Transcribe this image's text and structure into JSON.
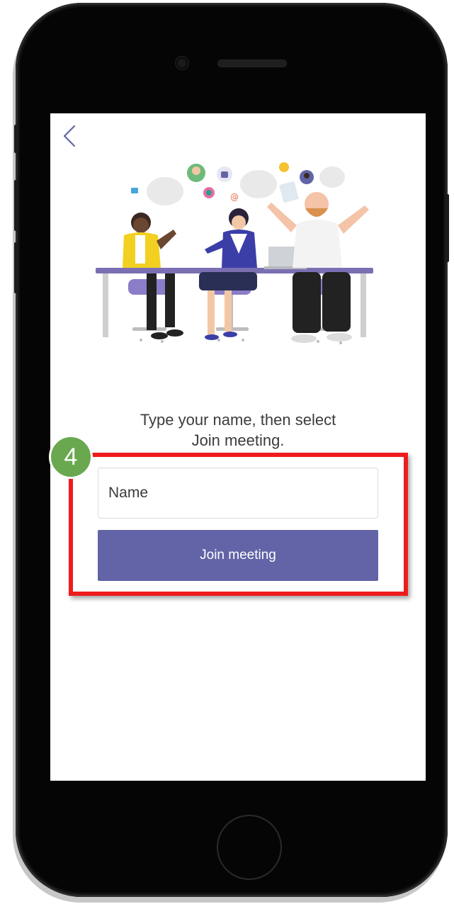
{
  "screen": {
    "back_icon": "chevron-left-icon",
    "illustration": "people-meeting-illustration",
    "instruction": "Type your name, then select\nJoin meeting.",
    "name_placeholder": "Name",
    "name_value": "",
    "join_button_label": "Join meeting"
  },
  "annotation": {
    "step_number": "4",
    "highlight_color": "#ee1c1c",
    "badge_color": "#6aa84f"
  },
  "colors": {
    "accent": "#6264a7",
    "phone_body": "#050505"
  }
}
